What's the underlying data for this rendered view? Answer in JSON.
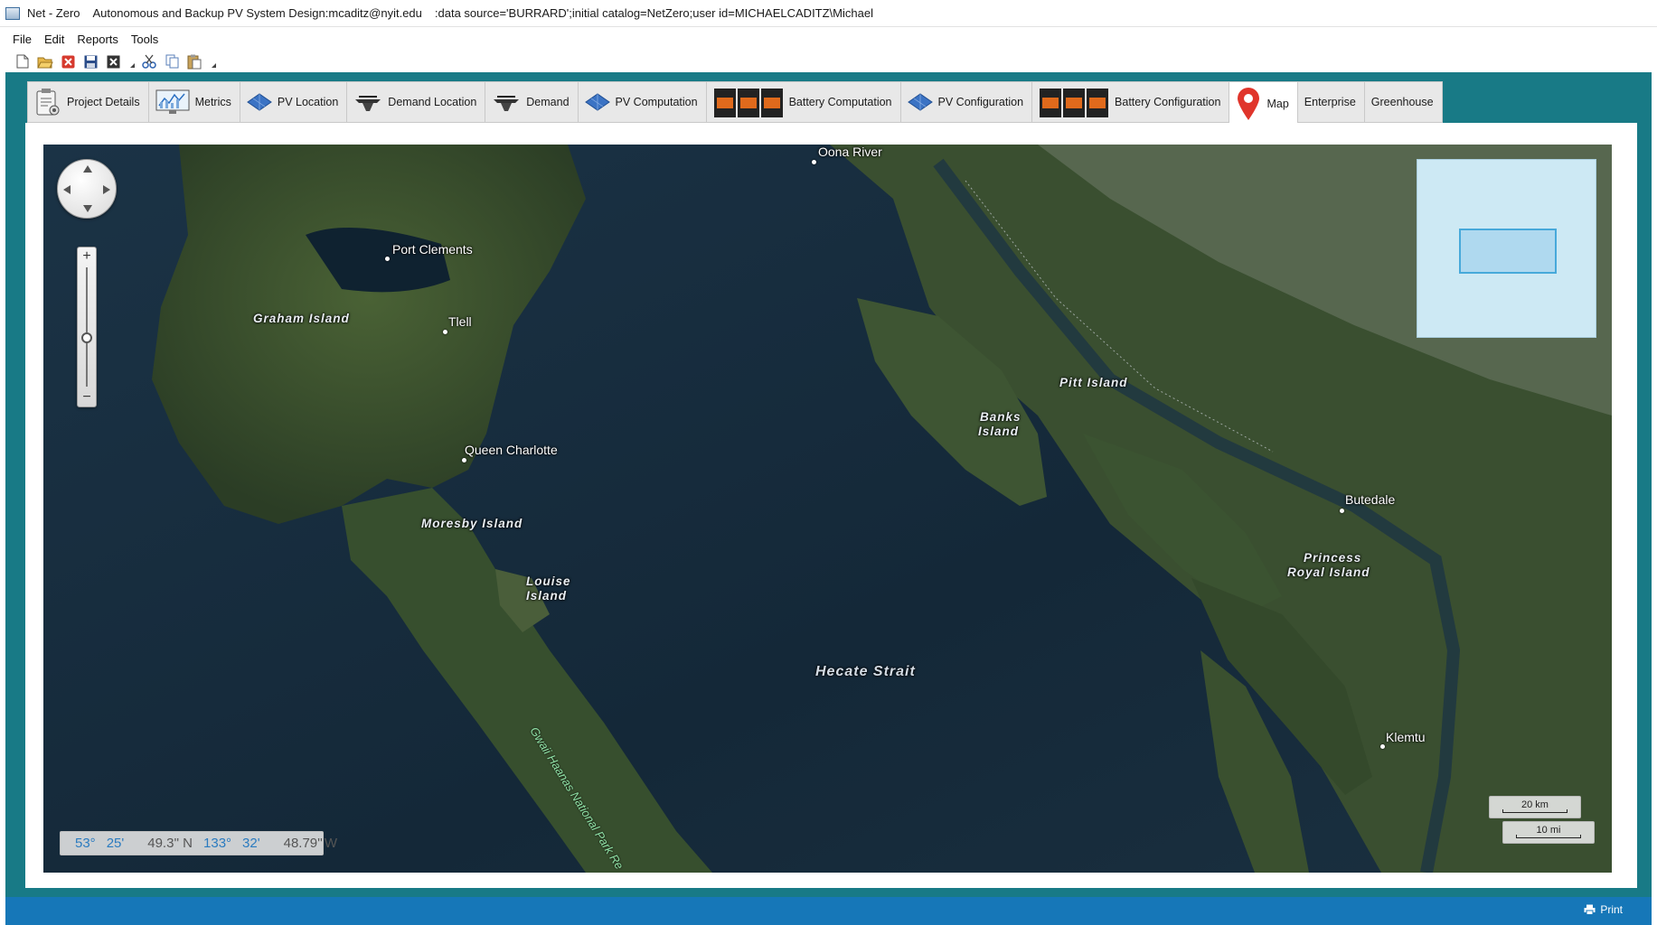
{
  "window": {
    "app_title": "Net - Zero",
    "doc_title": "Autonomous and Backup PV System Design:mcaditz@nyit.edu",
    "connection": ":data source='BURRARD';initial catalog=NetZero;user id=MICHAELCADITZ\\Michael"
  },
  "menu": {
    "file": "File",
    "edit": "Edit",
    "reports": "Reports",
    "tools": "Tools"
  },
  "toolbar": {
    "icons": [
      "new-icon",
      "open-icon",
      "delete-icon",
      "save-icon",
      "close-icon",
      "cut-icon",
      "copy-icon",
      "paste-icon"
    ]
  },
  "tabs": {
    "project_details": "Project Details",
    "metrics": "Metrics",
    "pv_location": "PV Location",
    "demand_location": "Demand Location",
    "demand": "Demand",
    "pv_computation": "PV Computation",
    "battery_computation": "Battery Computation",
    "pv_configuration": "PV Configuration",
    "battery_configuration": "Battery Configuration",
    "map": "Map",
    "enterprise": "Enterprise",
    "greenhouse": "Greenhouse",
    "active": "Map"
  },
  "map": {
    "places": {
      "oona_river": "Oona River",
      "port_clements": "Port Clements",
      "tlell": "Tlell",
      "queen_charlotte": "Queen Charlotte",
      "butedale": "Butedale",
      "klemtu": "Klemtu"
    },
    "regions": {
      "graham_island": "Graham Island",
      "pitt_island": "Pitt Island",
      "banks_island_1": "Banks",
      "banks_island_2": "Island",
      "moresby_island": "Moresby Island",
      "louise_island_1": "Louise",
      "louise_island_2": "Island",
      "princess_royal_1": "Princess",
      "princess_royal_2": "Royal Island"
    },
    "sea": "Hecate Strait",
    "park": "Gwaii Haanas National Park Re",
    "scale_km": "20 km",
    "scale_mi": "10 mi",
    "coords": {
      "lat_deg": "53°",
      "lat_min": "25'",
      "lat_sec": "49.3''",
      "lat_dir": "N",
      "lon_deg": "133°",
      "lon_min": "32'",
      "lon_sec": "48.79''",
      "lon_dir": "W"
    },
    "colors": {
      "water": "#152a3d",
      "land": "#34492b",
      "overview": "#cde9f4",
      "coord_blue": "#2a7bc0"
    }
  },
  "status": {
    "print": "Print"
  },
  "colors": {
    "frame": "#187a86",
    "statusbar": "#1677b8"
  }
}
